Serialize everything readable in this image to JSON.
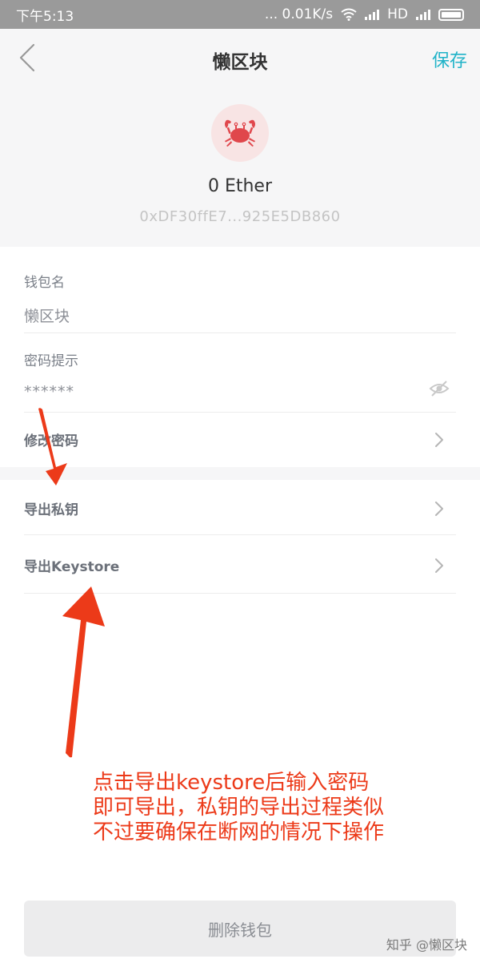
{
  "status_bar": {
    "time": "下午5:13",
    "network_speed": "... 0.01K/s",
    "network_type": "HD"
  },
  "nav": {
    "title": "懒区块",
    "save_label": "保存",
    "back_icon": "chevron-left-icon"
  },
  "wallet": {
    "avatar_icon": "crab-icon",
    "balance": "0 Ether",
    "address": "0xDF30ffE7...925E5DB860"
  },
  "fields": {
    "name_label": "钱包名",
    "name_value": "懒区块",
    "hint_label": "密码提示",
    "hint_value": "******",
    "eye_icon": "eye-hidden-icon"
  },
  "rows": {
    "change_password": "修改密码",
    "export_private_key": "导出私钥",
    "export_keystore": "导出Keystore"
  },
  "annotation": {
    "line1": "点击导出keystore后输入密码",
    "line2": "即可导出，私钥的导出过程类似",
    "line3": "不过要确保在断网的情况下操作",
    "color": "#ec3a19"
  },
  "delete_label": "删除钱包",
  "watermark": "知乎 @懒区块",
  "colors": {
    "accent": "#20b3c8",
    "avatar_bg": "#f8e4e4",
    "crab": "#e0474c"
  }
}
